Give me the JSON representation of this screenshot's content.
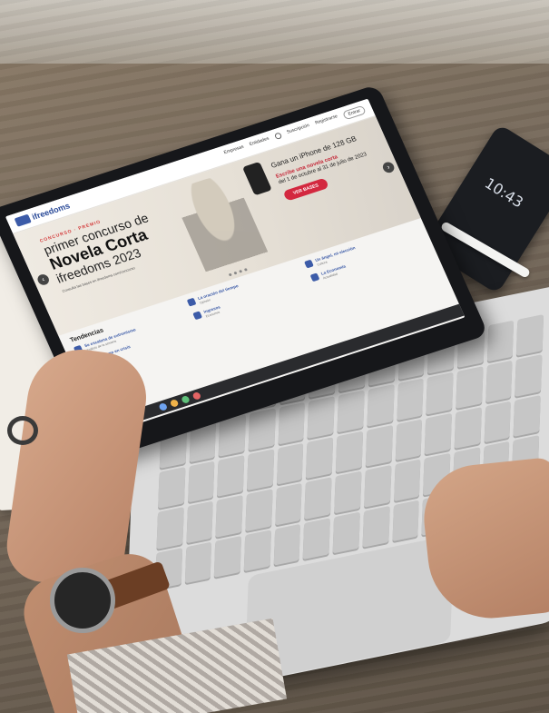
{
  "website": {
    "logo": "ifreedoms",
    "nav": [
      "Empresas",
      "Entidades",
      "Suscripción",
      "Registrarse",
      "Entrar"
    ],
    "banner": {
      "kicker": "CONCURSO · PREMIO",
      "line1": "primer concurso de",
      "line2": "Novela Corta",
      "line3": "ifreedoms 2023",
      "subtext": "Consulta las bases en ifreedoms.com/concurso",
      "prize": "Gana un iPhone de 128 GB",
      "call": "Escribe una novela corta",
      "call_dates": "del 1 de octubre al 31 de julio de 2023",
      "cta": "VER BASES"
    },
    "trends_title": "Tendencias",
    "trends": [
      {
        "title": "Se escalona de extremismo",
        "sub": "Análisis de la semana"
      },
      {
        "title": "Un gobierno en crisis",
        "sub": "Noticia destacada"
      },
      {
        "title": "La oración del tiempo",
        "sub": "Opinión"
      },
      {
        "title": "Ingresos",
        "sub": "Economía"
      },
      {
        "title": "Un ángel, mi elección",
        "sub": "Cultura"
      },
      {
        "title": "La Economía",
        "sub": "Actualidad"
      }
    ]
  },
  "phone": {
    "time": "10:43"
  }
}
